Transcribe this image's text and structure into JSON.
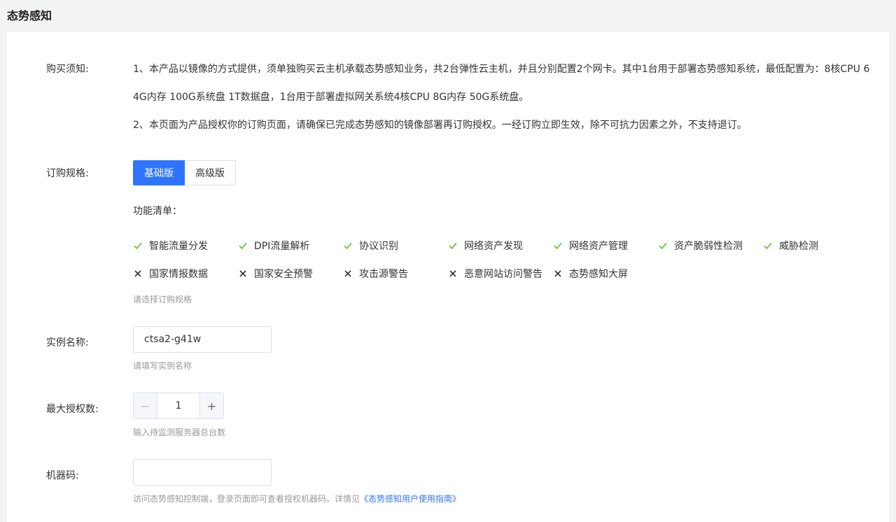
{
  "page_title": "态势感知",
  "notice": {
    "label": "购买须知:",
    "line1": "1、本产品以镜像的方式提供，须单独购买云主机承载态势感知业务，共2台弹性云主机，并且分别配置2个网卡。其中1台用于部署态势感知系统，最低配置为：8核CPU 6",
    "line2": "4G内存 100G系统盘 1T数据盘，1台用于部署虚拟网关系统4核CPU 8G内存 50G系统盘。",
    "line3": "2、本页面为产品授权你的订购页面，请确保已完成态势感知的镜像部署再订购授权。一经订购立即生效，除不可抗力因素之外，不支持退订。"
  },
  "spec": {
    "label": "订购规格:",
    "options": [
      "基础版",
      "高级版"
    ],
    "selected": "基础版",
    "feature_title": "功能清单：",
    "included": [
      "智能流量分发",
      "DPI流量解析",
      "协议识别",
      "网络资产发现",
      "网络资产管理",
      "资产脆弱性检测",
      "威胁检测"
    ],
    "excluded": [
      "国家情报数据",
      "国家安全预警",
      "攻击源警告",
      "恶意网站访问警告",
      "态势感知大屏"
    ],
    "hint": "请选择订购规格"
  },
  "instance": {
    "label": "实例名称:",
    "value": "ctsa2-g41w",
    "hint": "请填写实例名称"
  },
  "max_auth": {
    "label": "最大授权数:",
    "value": "1",
    "minus": "−",
    "plus": "+",
    "hint": "输入待监测服务器总台数"
  },
  "machine_code": {
    "label": "机器码:",
    "value": "",
    "hint_prefix": "访问态势感知控制端，登录页面即可查看授权机器码。详情见",
    "hint_link": "《态势感知用户使用指南》"
  },
  "colors": {
    "accent": "#2f74ff",
    "check": "#52c41a",
    "cross": "#333333"
  },
  "icons": {
    "included": "check-icon",
    "excluded": "close-icon"
  }
}
